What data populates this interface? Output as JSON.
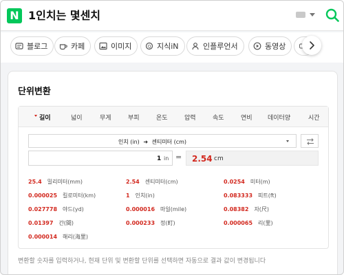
{
  "header": {
    "logo_text": "N",
    "query": "1인치는 몇센치",
    "brand_color": "#03c75a"
  },
  "tabs": [
    {
      "label": "블로그",
      "icon": "blog-icon"
    },
    {
      "label": "카페",
      "icon": "cafe-icon"
    },
    {
      "label": "이미지",
      "icon": "image-icon"
    },
    {
      "label": "지식iN",
      "icon": "qa-icon"
    },
    {
      "label": "인플루언서",
      "icon": "person-icon"
    },
    {
      "label": "동영상",
      "icon": "play-icon"
    }
  ],
  "converter": {
    "title": "단위변환",
    "categories": [
      "길이",
      "넓이",
      "무게",
      "부피",
      "온도",
      "압력",
      "속도",
      "연비",
      "데이터양",
      "시간"
    ],
    "active_category": "길이",
    "unit_pair": {
      "from": "인치 (in)",
      "arrow": "➜",
      "to": "센티미터 (cm)"
    },
    "input": {
      "value": "1",
      "unit": "in"
    },
    "equals": "=",
    "output": {
      "value": "2.54",
      "unit": "cm"
    },
    "results": [
      {
        "value": "25.4",
        "unit": "밀리미터(mm)"
      },
      {
        "value": "2.54",
        "unit": "센티미터(cm)"
      },
      {
        "value": "0.0254",
        "unit": "미터(m)"
      },
      {
        "value": "0.000025",
        "unit": "킬로미터(km)"
      },
      {
        "value": "1",
        "unit": "인치(in)"
      },
      {
        "value": "0.083333",
        "unit": "피트(ft)"
      },
      {
        "value": "0.027778",
        "unit": "야드(yd)"
      },
      {
        "value": "0.000016",
        "unit": "마일(mile)"
      },
      {
        "value": "0.08382",
        "unit": "자(尺)"
      },
      {
        "value": "0.01397",
        "unit": "간(間)"
      },
      {
        "value": "0.000233",
        "unit": "정(町)"
      },
      {
        "value": "0.000065",
        "unit": "리(里)"
      },
      {
        "value": "0.000014",
        "unit": "해리(海里)"
      }
    ],
    "footnote": "변환할 숫자를 입력하거나, 현재 단위 및 변환할 단위를 선택하면 자동으로 결과 값이 변경됩니다",
    "accent_color": "#d2281e"
  }
}
